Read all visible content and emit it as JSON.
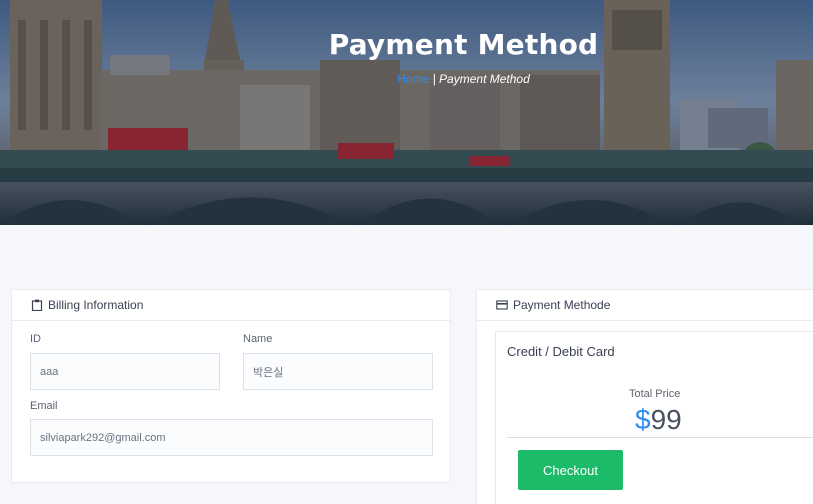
{
  "hero": {
    "title": "Payment Method",
    "breadcrumb": {
      "home": "Home",
      "separator": " | ",
      "current": "Payment Method"
    }
  },
  "billing": {
    "header": "Billing Information",
    "id_label": "ID",
    "id_value": "aaa",
    "name_label": "Name",
    "name_value": "박은실",
    "email_label": "Email",
    "email_value": "silviapark292@gmail.com"
  },
  "payment": {
    "header": "Payment Methode",
    "method_title": "Credit / Debit Card",
    "total_label": "Total Price",
    "currency": "$",
    "amount": "99",
    "checkout_label": "Checkout"
  },
  "colors": {
    "accent_blue": "#2f8cf0",
    "checkout_green": "#1cbb6a",
    "page_bg": "#f5f7fb"
  },
  "icons": {
    "billing_icon": "clipboard-icon",
    "payment_icon": "credit-card-icon"
  }
}
